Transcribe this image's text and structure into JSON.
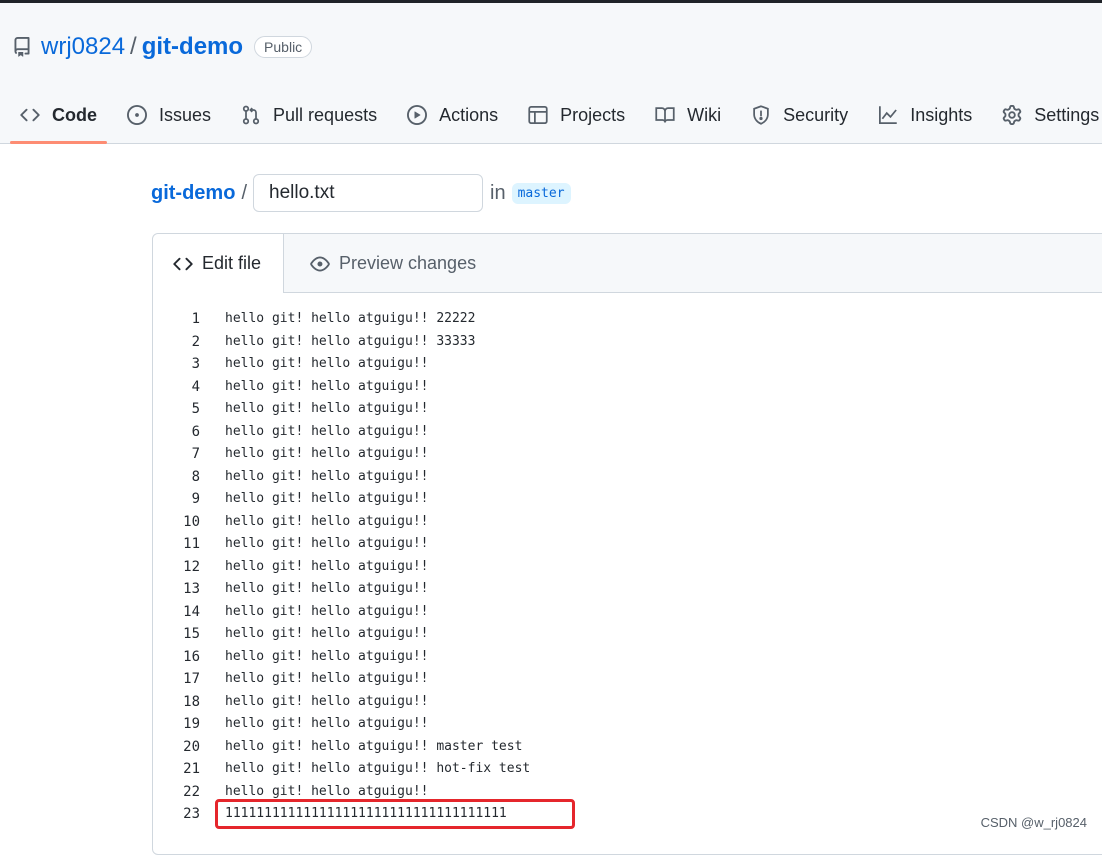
{
  "repo": {
    "owner": "wrj0824",
    "separator": "/",
    "name": "git-demo",
    "visibility": "Public"
  },
  "nav": {
    "tabs": [
      {
        "label": "Code",
        "icon": "code-icon",
        "selected": true
      },
      {
        "label": "Issues",
        "icon": "issue-icon"
      },
      {
        "label": "Pull requests",
        "icon": "pull-request-icon"
      },
      {
        "label": "Actions",
        "icon": "play-icon"
      },
      {
        "label": "Projects",
        "icon": "table-icon"
      },
      {
        "label": "Wiki",
        "icon": "book-icon"
      },
      {
        "label": "Security",
        "icon": "shield-icon"
      },
      {
        "label": "Insights",
        "icon": "graph-icon"
      },
      {
        "label": "Settings",
        "icon": "gear-icon"
      }
    ]
  },
  "breadcrumb": {
    "repo": "git-demo",
    "separator": "/",
    "filename": "hello.txt",
    "in_word": "in",
    "branch": "master"
  },
  "editor": {
    "tabs": {
      "edit": "Edit file",
      "preview": "Preview changes"
    },
    "lines": [
      {
        "n": "1",
        "text": "hello git! hello atguigu!! 22222"
      },
      {
        "n": "2",
        "text": "hello git! hello atguigu!! 33333"
      },
      {
        "n": "3",
        "text": "hello git! hello atguigu!!"
      },
      {
        "n": "4",
        "text": "hello git! hello atguigu!!"
      },
      {
        "n": "5",
        "text": "hello git! hello atguigu!!"
      },
      {
        "n": "6",
        "text": "hello git! hello atguigu!!"
      },
      {
        "n": "7",
        "text": "hello git! hello atguigu!!"
      },
      {
        "n": "8",
        "text": "hello git! hello atguigu!!"
      },
      {
        "n": "9",
        "text": "hello git! hello atguigu!!"
      },
      {
        "n": "10",
        "text": "hello git! hello atguigu!!"
      },
      {
        "n": "11",
        "text": "hello git! hello atguigu!!"
      },
      {
        "n": "12",
        "text": "hello git! hello atguigu!!"
      },
      {
        "n": "13",
        "text": "hello git! hello atguigu!!"
      },
      {
        "n": "14",
        "text": "hello git! hello atguigu!!"
      },
      {
        "n": "15",
        "text": "hello git! hello atguigu!!"
      },
      {
        "n": "16",
        "text": "hello git! hello atguigu!!"
      },
      {
        "n": "17",
        "text": "hello git! hello atguigu!!"
      },
      {
        "n": "18",
        "text": "hello git! hello atguigu!!"
      },
      {
        "n": "19",
        "text": "hello git! hello atguigu!!"
      },
      {
        "n": "20",
        "text": "hello git! hello atguigu!! master test"
      },
      {
        "n": "21",
        "text": "hello git! hello atguigu!! hot-fix test"
      },
      {
        "n": "22",
        "text": "hello git! hello atguigu!!"
      },
      {
        "n": "23",
        "text": "111111111111111111111111111111111111",
        "highlighted": true
      }
    ]
  },
  "colors": {
    "link": "#0969da",
    "tab_underline": "#fd8c73",
    "annotation": "#e5262c",
    "branch_bg": "#ddf4ff"
  },
  "watermark": "CSDN @w_rj0824"
}
